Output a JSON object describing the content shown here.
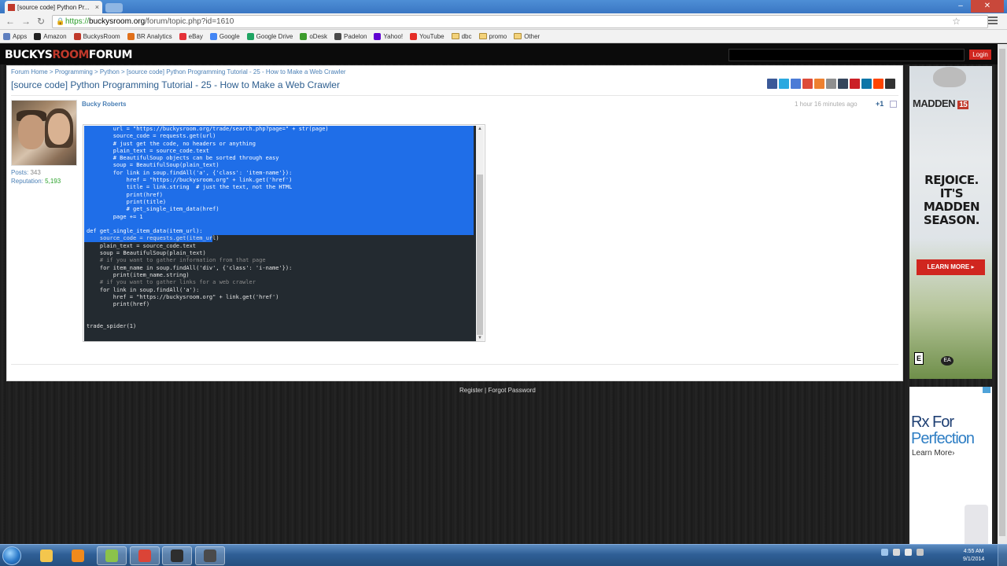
{
  "browser": {
    "tab_title": "[source code] Python Pr...",
    "tab_close": "×",
    "url_scheme": "https://",
    "url_host": "buckysroom.org",
    "url_path": "/forum/topic.php?id=1610",
    "bookmarks": [
      {
        "label": "Apps",
        "color": "#5f7fbf",
        "type": "icon"
      },
      {
        "label": "Amazon",
        "color": "#222222",
        "type": "icon"
      },
      {
        "label": "BuckysRoom",
        "color": "#c0392b",
        "type": "icon"
      },
      {
        "label": "BR Analytics",
        "color": "#e0701a",
        "type": "icon"
      },
      {
        "label": "eBay",
        "color": "#e53238",
        "type": "icon"
      },
      {
        "label": "Google",
        "color": "#4285f4",
        "type": "icon"
      },
      {
        "label": "Google Drive",
        "color": "#1fa463",
        "type": "icon"
      },
      {
        "label": "oDesk",
        "color": "#3c9b2c",
        "type": "icon"
      },
      {
        "label": "Padelon",
        "color": "#4a4a4a",
        "type": "icon"
      },
      {
        "label": "Yahoo!",
        "color": "#5f01d1",
        "type": "icon"
      },
      {
        "label": "YouTube",
        "color": "#e52d27",
        "type": "icon"
      },
      {
        "label": "dbc",
        "color": "#f3d27a",
        "type": "folder"
      },
      {
        "label": "promo",
        "color": "#f3d27a",
        "type": "folder"
      },
      {
        "label": "Other",
        "color": "#f3d27a",
        "type": "folder"
      }
    ]
  },
  "site": {
    "logo_part1": "BUCKYS",
    "logo_part2": "ROOM",
    "logo_part3": "FORUM",
    "login_label": "Login",
    "breadcrumb": "Forum Home > Programming > Python > [source code] Python Programming Tutorial - 25 - How to Make a Web Crawler",
    "topic_title": "[source code] Python Programming Tutorial - 25 - How to Make a Web Crawler",
    "share_colors": [
      "#3b5998",
      "#2aa9e0",
      "#4b7bd6",
      "#dd4b39",
      "#ee802f",
      "#8f8f8f",
      "#35465c",
      "#cb2027",
      "#0e76a8",
      "#ff4500",
      "#333333"
    ]
  },
  "post": {
    "author": "Bucky Roberts",
    "posts_label": "Posts:",
    "posts_value": "343",
    "reputation_label": "Reputation:",
    "reputation_value": "5,193",
    "time_ago": "1 hour 16 minutes ago",
    "plus_one": "+1",
    "code_lines": [
      {
        "t": "        url = \"https://buckysroom.org/trade/search.php?page=\" + str(page)",
        "c": "ws"
      },
      {
        "t": "        source_code = requests.get(url)",
        "c": "ws"
      },
      {
        "t": "        # just get the code, no headers or anything",
        "c": "ws"
      },
      {
        "t": "        plain_text = source_code.text",
        "c": "ws"
      },
      {
        "t": "        # BeautifulSoup objects can be sorted through easy",
        "c": "ws"
      },
      {
        "t": "        soup = BeautifulSoup(plain_text)",
        "c": "ws"
      },
      {
        "t": "        for link in soup.findAll('a', {'class': 'item-name'}):",
        "c": "ws"
      },
      {
        "t": "            href = \"https://buckysroom.org\" + link.get('href')",
        "c": "ws"
      },
      {
        "t": "            title = link.string  # just the text, not the HTML",
        "c": "ws"
      },
      {
        "t": "            print(href)",
        "c": "ws"
      },
      {
        "t": "            print(title)",
        "c": "ws"
      },
      {
        "t": "            # get_single_item_data(href)",
        "c": "ws"
      },
      {
        "t": "        page += 1",
        "c": "ws"
      },
      {
        "t": "",
        "c": "ws"
      },
      {
        "t": "def get_single_item_data(item_url):",
        "c": "ws"
      },
      {
        "t": "    source_code = requests.get(item_url)",
        "c": "ws"
      },
      {
        "t": "    plain_text = source_code.text",
        "c": "ws"
      },
      {
        "t": "    soup = BeautifulSoup(plain_text)",
        "c": "ws"
      },
      {
        "t": "    # if you want to gather information from that page",
        "c": "cm"
      },
      {
        "t": "    for item_name in soup.findAll('div', {'class': 'i-name'}):",
        "c": "ws"
      },
      {
        "t": "        print(item_name.string)",
        "c": "ws"
      },
      {
        "t": "    # if you want to gather links for a web crawler",
        "c": "cm"
      },
      {
        "t": "    for link in soup.findAll('a'):",
        "c": "ws"
      },
      {
        "t": "        href = \"https://buckysroom.org\" + link.get('href')",
        "c": "ws"
      },
      {
        "t": "        print(href)",
        "c": "ws"
      },
      {
        "t": "",
        "c": "ws"
      },
      {
        "t": "",
        "c": "ws"
      },
      {
        "t": "trade_spider(1)",
        "c": "ws"
      }
    ]
  },
  "footer": {
    "links": "Register | Forgot Password"
  },
  "ads": {
    "madden_title": "MADDEN",
    "madden_num": "15",
    "madden_slogan": "REJOICE. IT'S MADDEN SEASON.",
    "madden_cta": "LEARN MORE ▸",
    "esrb": "E",
    "ea": "EA",
    "rx_line1": "Rx For",
    "rx_line2": "Perfection",
    "rx_cta": "Learn More›"
  },
  "taskbar": {
    "apps": [
      {
        "name": "explorer",
        "color": "#f4c64d",
        "active": false
      },
      {
        "name": "media-player",
        "color": "#f08a1c",
        "active": false
      },
      {
        "name": "editor",
        "color": "#8bc34a",
        "active": true
      },
      {
        "name": "chrome",
        "color": "#db4437",
        "active": true
      },
      {
        "name": "app5",
        "color": "#2e2e2e",
        "active": true
      },
      {
        "name": "app6",
        "color": "#4a4a4a",
        "active": true
      }
    ],
    "time": "4:55 AM",
    "date": "9/1/2014"
  }
}
